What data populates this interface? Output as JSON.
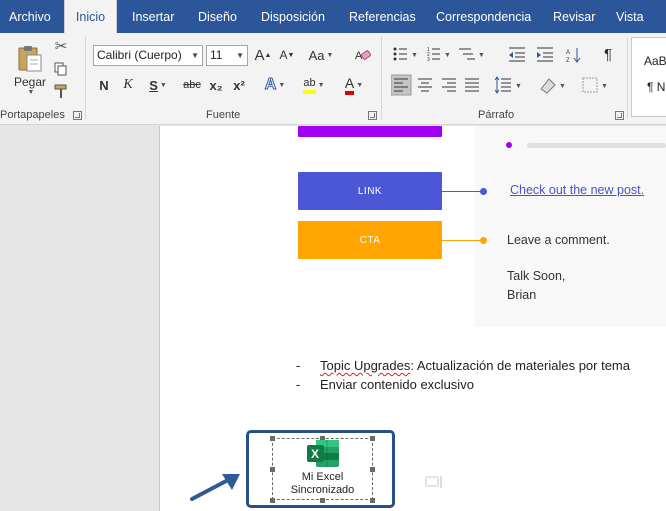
{
  "menu": {
    "tabs": [
      {
        "label": "Archivo"
      },
      {
        "label": "Inicio"
      },
      {
        "label": "Insertar"
      },
      {
        "label": "Diseño"
      },
      {
        "label": "Disposición"
      },
      {
        "label": "Referencias"
      },
      {
        "label": "Correspondencia"
      },
      {
        "label": "Revisar"
      },
      {
        "label": "Vista"
      }
    ],
    "active_tab": "Inicio"
  },
  "ribbon": {
    "clipboard": {
      "paste_label": "Pegar",
      "group_label": "Portapapeles"
    },
    "font": {
      "font_name": "Calibri (Cuerpo)",
      "font_size": "11",
      "grow_label": "A",
      "shrink_label": "A",
      "case_label": "Aa",
      "bold": "N",
      "italic": "K",
      "underline": "S",
      "strike": "abc",
      "subscript": "x₂",
      "superscript": "x²",
      "effects": "A",
      "highlight": "ab",
      "font_color": "A",
      "group_label": "Fuente"
    },
    "paragraph": {
      "pilcrow": "¶",
      "group_label": "Párrafo"
    },
    "styles": {
      "preview_1": "AaB",
      "preview_2": "¶ N"
    }
  },
  "document": {
    "flow_boxes": [
      {
        "label": "",
        "color": "#a100f2"
      },
      {
        "label": "LINK",
        "color": "#4c57d5"
      },
      {
        "label": "CTA",
        "color": "#ffa400"
      }
    ],
    "email": {
      "link_text": "Check out the new post.",
      "cta_text": "Leave a comment.",
      "signoff": "Talk Soon,",
      "name": "Brian"
    },
    "bullets": [
      {
        "dash": "-",
        "term": "Topic Upgrades",
        "rest": ": Actualización de materiales por tema"
      },
      {
        "dash": "-",
        "term": "",
        "rest": "Enviar contenido exclusivo"
      }
    ],
    "embedded_object": {
      "line1": "Mi Excel",
      "line2": "Sincronizado",
      "icon": "excel-icon"
    }
  },
  "colors": {
    "tab_bar": "#2b579a",
    "highlight_yellow": "#ffff00",
    "font_red": "#e00000",
    "object_outline": "#284f86",
    "arrow": "#2e5a96"
  }
}
